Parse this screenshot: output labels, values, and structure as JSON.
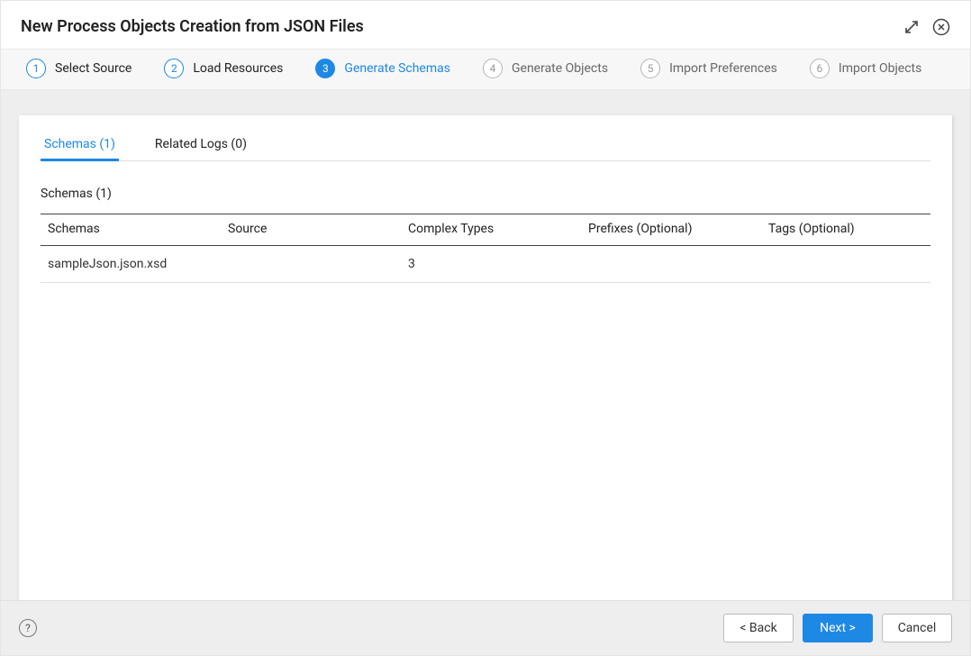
{
  "header": {
    "title": "New Process Objects Creation from JSON Files"
  },
  "steps": [
    {
      "num": "1",
      "label": "Select Source",
      "state": "completed"
    },
    {
      "num": "2",
      "label": "Load Resources",
      "state": "completed"
    },
    {
      "num": "3",
      "label": "Generate Schemas",
      "state": "current"
    },
    {
      "num": "4",
      "label": "Generate Objects",
      "state": "upcoming"
    },
    {
      "num": "5",
      "label": "Import Preferences",
      "state": "upcoming"
    },
    {
      "num": "6",
      "label": "Import Objects",
      "state": "upcoming"
    }
  ],
  "tabs": [
    {
      "label": "Schemas (1)",
      "active": true
    },
    {
      "label": "Related Logs (0)",
      "active": false
    }
  ],
  "section": {
    "heading": "Schemas (1)"
  },
  "table": {
    "columns": {
      "schemas": "Schemas",
      "source": "Source",
      "complexTypes": "Complex Types",
      "prefixes": "Prefixes (Optional)",
      "tags": "Tags (Optional)"
    },
    "rows": [
      {
        "schemas": "sampleJson.json.xsd",
        "source": "",
        "complexTypes": "3",
        "prefixes": "",
        "tags": ""
      }
    ]
  },
  "footer": {
    "help": "?",
    "back": "< Back",
    "next": "Next >",
    "cancel": "Cancel"
  }
}
